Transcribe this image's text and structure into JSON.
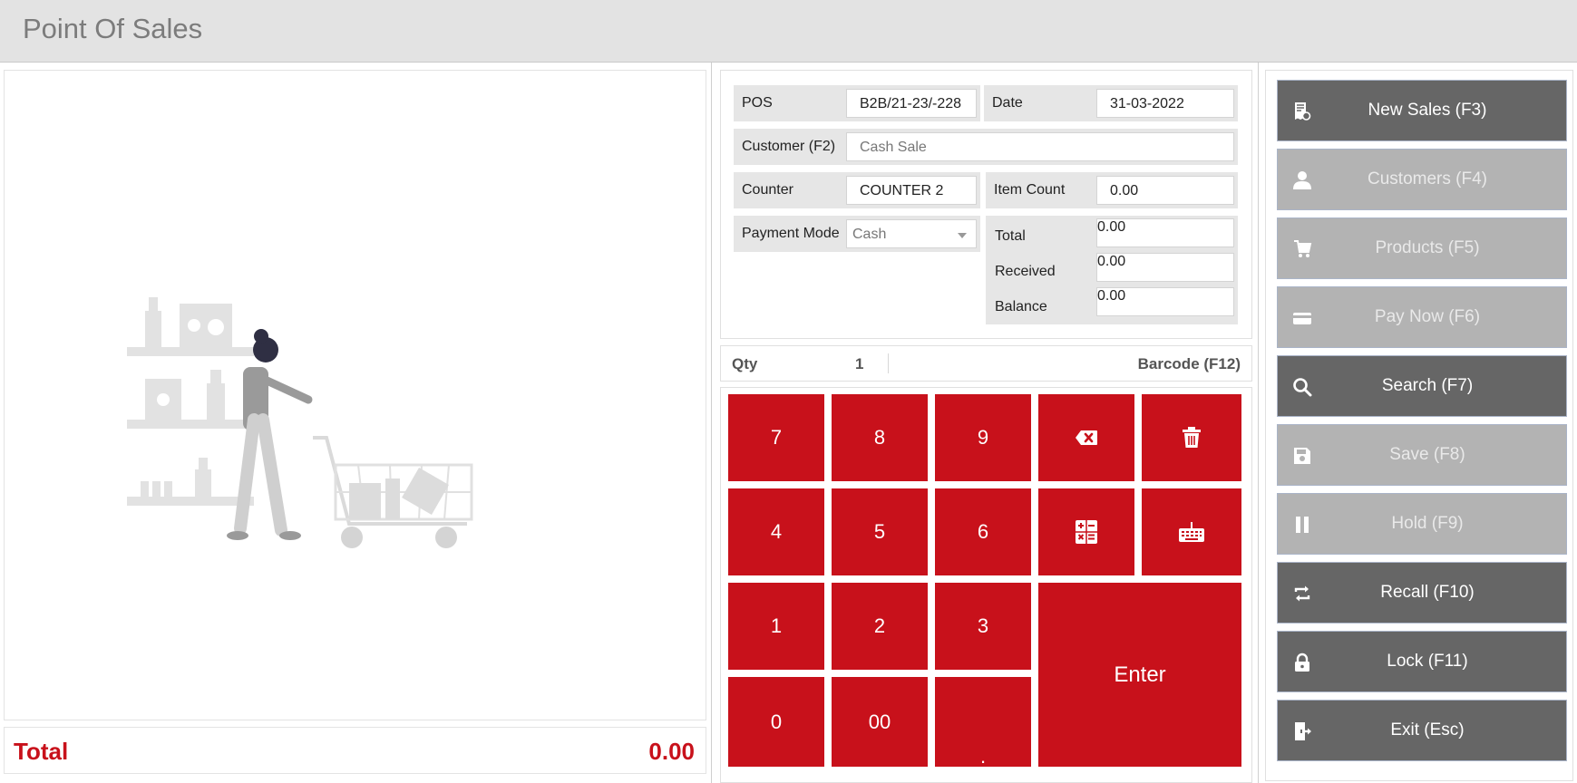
{
  "app": {
    "title": "Point Of Sales"
  },
  "cart": {
    "total_label": "Total",
    "total_value": "0.00"
  },
  "form": {
    "pos_label": "POS",
    "pos_value": "B2B/21-23/-228",
    "date_label": "Date",
    "date_value": "31-03-2022",
    "customer_label": "Customer (F2)",
    "customer_value": "Cash Sale",
    "counter_label": "Counter",
    "counter_value": "COUNTER 2",
    "item_count_label": "Item Count",
    "item_count_value": "0.00",
    "payment_mode_label": "Payment Mode",
    "payment_mode_value": "Cash",
    "total_label": "Total",
    "total_value": "0.00",
    "received_label": "Received",
    "received_value": "0.00",
    "balance_label": "Balance",
    "balance_value": "0.00"
  },
  "entry": {
    "qty_label": "Qty",
    "qty_value": "1",
    "barcode_label": "Barcode (F12)"
  },
  "keypad": {
    "k7": "7",
    "k8": "8",
    "k9": "9",
    "k4": "4",
    "k5": "5",
    "k6": "6",
    "k1": "1",
    "k2": "2",
    "k3": "3",
    "k0": "0",
    "k00": "00",
    "kdot": ".",
    "enter": "Enter",
    "icons": [
      "backspace-icon",
      "trash-icon",
      "calculator-icon",
      "keyboard-icon"
    ]
  },
  "actions": [
    {
      "label": "New Sales (F3)",
      "icon": "receipt-icon",
      "enabled": true
    },
    {
      "label": "Customers (F4)",
      "icon": "user-icon",
      "enabled": false
    },
    {
      "label": "Products (F5)",
      "icon": "cart-icon",
      "enabled": false
    },
    {
      "label": "Pay Now (F6)",
      "icon": "card-icon",
      "enabled": false
    },
    {
      "label": "Search (F7)",
      "icon": "search-icon",
      "enabled": true
    },
    {
      "label": "Save (F8)",
      "icon": "save-icon",
      "enabled": false
    },
    {
      "label": "Hold (F9)",
      "icon": "pause-icon",
      "enabled": false
    },
    {
      "label": "Recall (F10)",
      "icon": "recall-icon",
      "enabled": true
    },
    {
      "label": "Lock (F11)",
      "icon": "lock-icon",
      "enabled": true
    },
    {
      "label": "Exit (Esc)",
      "icon": "exit-icon",
      "enabled": true
    }
  ],
  "colors": {
    "accent": "#c8111b",
    "button_dark": "#666666",
    "button_disabled": "#b3b3b3"
  }
}
